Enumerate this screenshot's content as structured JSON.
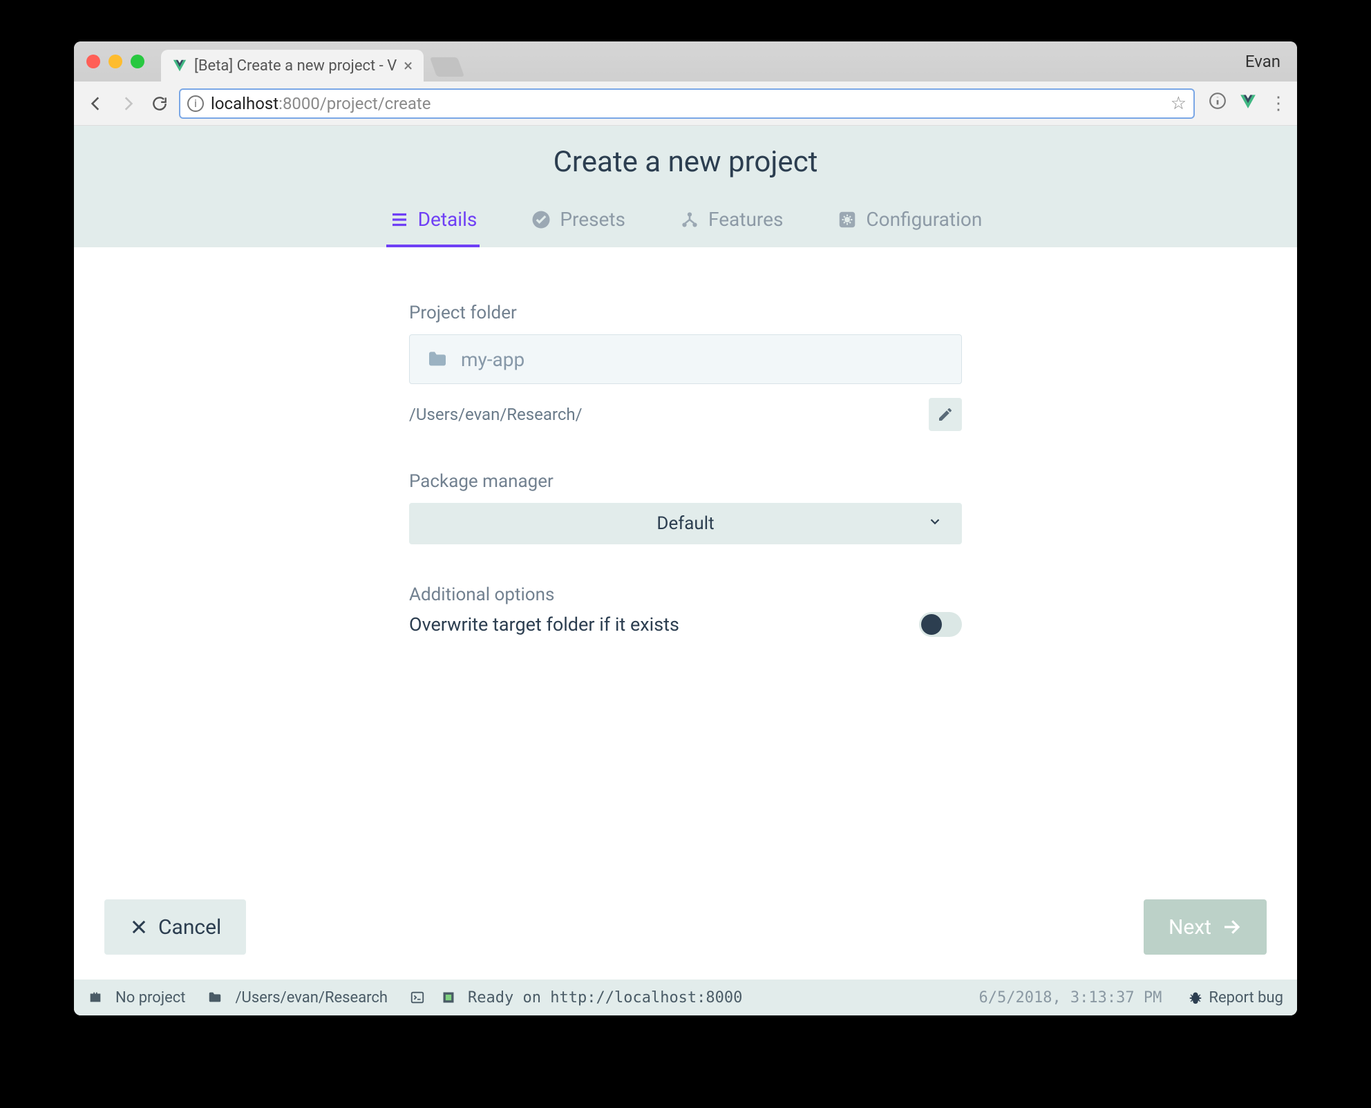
{
  "browser": {
    "tab_title": "[Beta] Create a new project - V",
    "profile": "Evan",
    "url_host": "localhost",
    "url_port_path": ":8000/project/create"
  },
  "header": {
    "title": "Create a new project",
    "tabs": {
      "details": "Details",
      "presets": "Presets",
      "features": "Features",
      "configuration": "Configuration"
    }
  },
  "form": {
    "project_folder_label": "Project folder",
    "project_folder_value": "my-app",
    "project_folder_path": "/Users/evan/Research/",
    "package_manager_label": "Package manager",
    "package_manager_value": "Default",
    "additional_options_label": "Additional options",
    "overwrite_label": "Overwrite target folder if it exists"
  },
  "actions": {
    "cancel": "Cancel",
    "next": "Next"
  },
  "status": {
    "project": "No project",
    "cwd": "/Users/evan/Research",
    "ready": "Ready on http://localhost:8000",
    "timestamp": "6/5/2018, 3:13:37 PM",
    "report_bug": "Report bug"
  }
}
